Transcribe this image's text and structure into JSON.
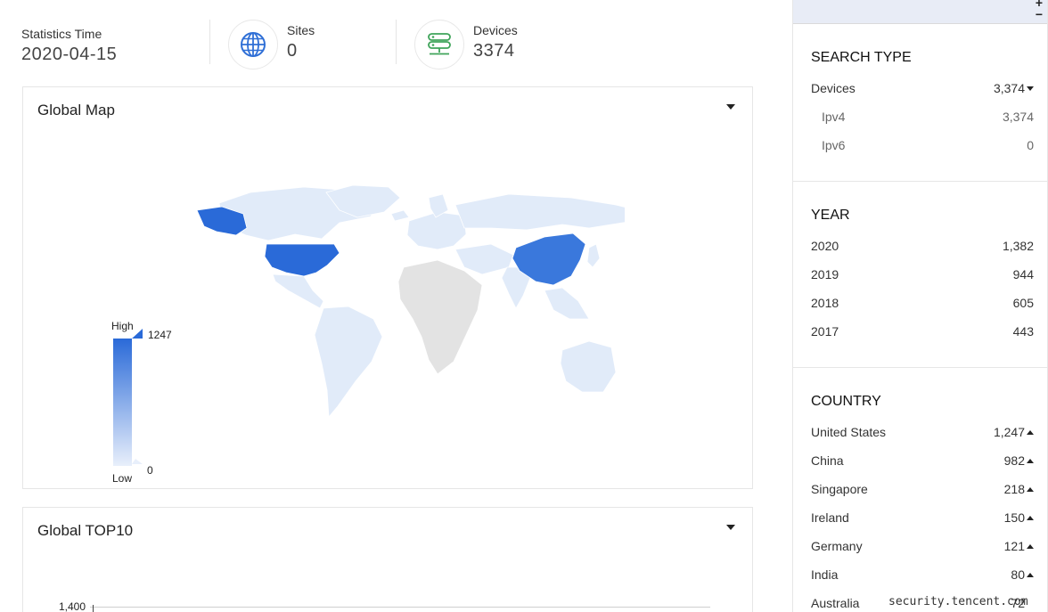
{
  "stats": {
    "time_label": "Statistics Time",
    "time_value": "2020-04-15",
    "sites_label": "Sites",
    "sites_value": "0",
    "devices_label": "Devices",
    "devices_value": "3374",
    "icons": {
      "sites": "globe-icon",
      "devices": "server-icon"
    },
    "colors": {
      "globe": "#2f6fd6",
      "server": "#3fa45a"
    }
  },
  "map_panel": {
    "title": "Global Map",
    "legend": {
      "high_label": "High",
      "low_label": "Low",
      "max_value": "1247",
      "min_value": "0"
    },
    "highlight_colors": {
      "high": "#2a6ad8",
      "medium": "#e1ebf9",
      "none": "#e3e3e3"
    }
  },
  "top10_panel": {
    "title": "Global TOP10",
    "y_tick_top": "1,400"
  },
  "sidebar": {
    "search_type": {
      "title": "SEARCH TYPE",
      "items": [
        {
          "label": "Devices",
          "count": "3,374"
        },
        {
          "label": "Ipv4",
          "count": "3,374"
        },
        {
          "label": "Ipv6",
          "count": "0"
        }
      ]
    },
    "year": {
      "title": "YEAR",
      "items": [
        {
          "label": "2020",
          "count": "1,382"
        },
        {
          "label": "2019",
          "count": "944"
        },
        {
          "label": "2018",
          "count": "605"
        },
        {
          "label": "2017",
          "count": "443"
        }
      ]
    },
    "country": {
      "title": "COUNTRY",
      "items": [
        {
          "label": "United States",
          "count": "1,247"
        },
        {
          "label": "China",
          "count": "982"
        },
        {
          "label": "Singapore",
          "count": "218"
        },
        {
          "label": "Ireland",
          "count": "150"
        },
        {
          "label": "Germany",
          "count": "121"
        },
        {
          "label": "India",
          "count": "80"
        },
        {
          "label": "Australia",
          "count": "72"
        }
      ]
    }
  },
  "watermark": "security.tencent.com"
}
